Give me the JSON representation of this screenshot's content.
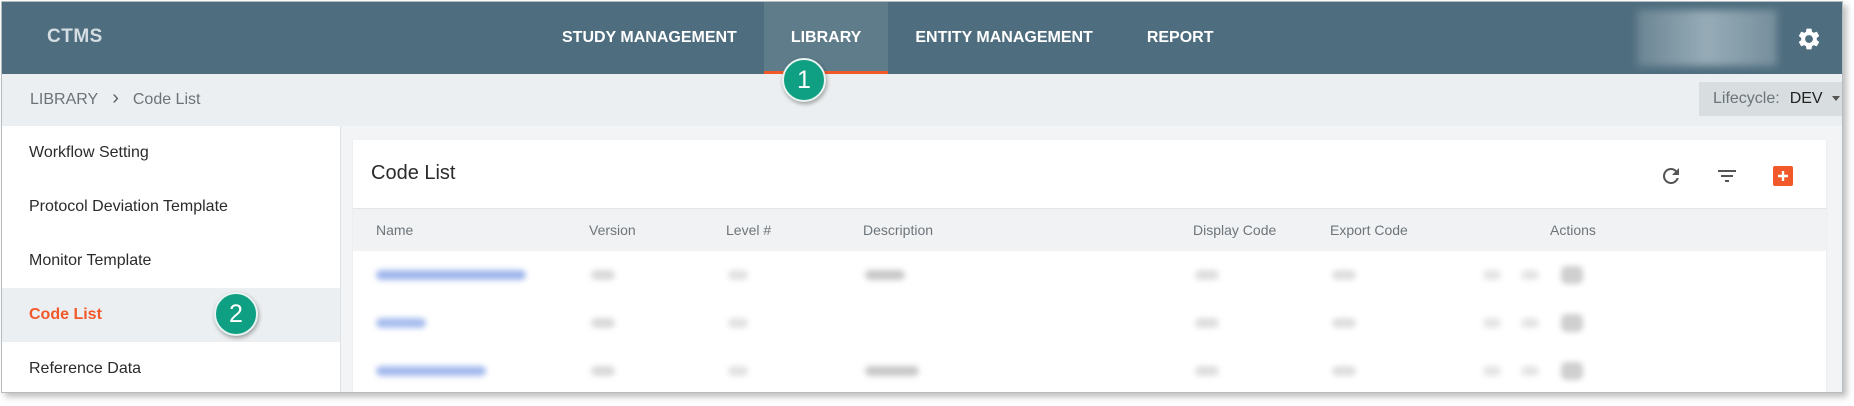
{
  "app": {
    "brand": "CTMS"
  },
  "nav": {
    "items": [
      {
        "label": "STUDY MANAGEMENT"
      },
      {
        "label": "LIBRARY"
      },
      {
        "label": "ENTITY MANAGEMENT"
      },
      {
        "label": "REPORT"
      }
    ],
    "active": "LIBRARY"
  },
  "callouts": {
    "one": "1",
    "two": "2"
  },
  "breadcrumb": {
    "root": "LIBRARY",
    "current": "Code List"
  },
  "lifecycle": {
    "label": "Lifecycle:",
    "value": "DEV"
  },
  "sidebar": {
    "items": [
      {
        "label": "Workflow Setting"
      },
      {
        "label": "Protocol Deviation Template"
      },
      {
        "label": "Monitor Template"
      },
      {
        "label": "Code List"
      },
      {
        "label": "Reference Data"
      }
    ],
    "active": "Code List"
  },
  "panel": {
    "title": "Code List",
    "tools": [
      "refresh-icon",
      "filter-icon",
      "add-icon"
    ]
  },
  "table": {
    "columns": [
      "Name",
      "Version",
      "Level #",
      "Description",
      "Display Code",
      "Export Code",
      "Actions"
    ]
  },
  "colors": {
    "topbar": "#4e6d7e",
    "accent": "#f1592a",
    "callout": "#0f9f82",
    "link": "#3b6fd8"
  }
}
